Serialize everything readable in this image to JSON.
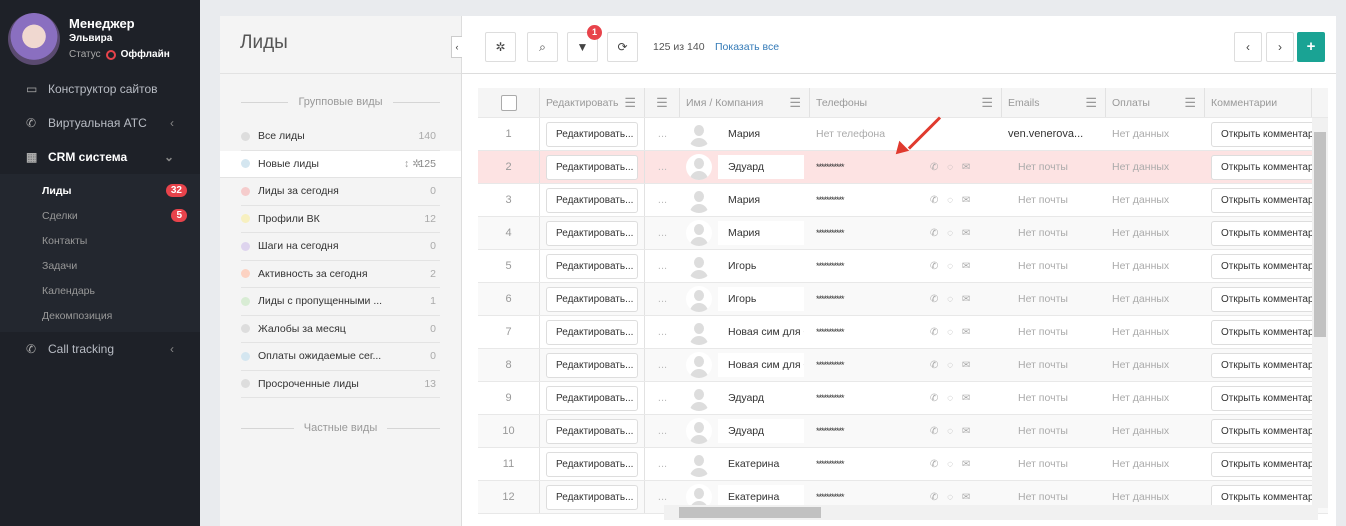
{
  "sidebar": {
    "user_role": "Менеджер",
    "user_name": "Эльвира",
    "status_label": "Статус",
    "status_value": "Оффлайн",
    "nav": [
      {
        "label": "Конструктор сайтов",
        "icon": "monitor-icon"
      },
      {
        "label": "Виртуальная АТС",
        "icon": "phone-icon"
      },
      {
        "label": "CRM система",
        "icon": "calendar-icon"
      },
      {
        "label": "Call tracking",
        "icon": "call-tracking-icon"
      }
    ],
    "crm_sub": [
      {
        "label": "Лиды",
        "badge": "32"
      },
      {
        "label": "Сделки",
        "badge": "5"
      },
      {
        "label": "Контакты"
      },
      {
        "label": "Задачи"
      },
      {
        "label": "Календарь"
      },
      {
        "label": "Декомпозиция"
      }
    ]
  },
  "leftpanel": {
    "title": "Лиды",
    "group_header": "Групповые виды",
    "private_header": "Частные виды",
    "groups": [
      {
        "label": "Все лиды",
        "count": "140",
        "color": "#dddddd"
      },
      {
        "label": "Новые лиды",
        "count": "125",
        "color": "#d4e6f0"
      },
      {
        "label": "Лиды за сегодня",
        "count": "0",
        "color": "#f5cccc"
      },
      {
        "label": "Профили ВК",
        "count": "12",
        "color": "#f7f0c0"
      },
      {
        "label": "Шаги на сегодня",
        "count": "0",
        "color": "#ded4ee"
      },
      {
        "label": "Активность за сегодня",
        "count": "2",
        "color": "#fcd2c2"
      },
      {
        "label": "Лиды с пропущенными ...",
        "count": "1",
        "color": "#d8ecd4"
      },
      {
        "label": "Жалобы за месяц",
        "count": "0",
        "color": "#dddddd"
      },
      {
        "label": "Оплаты ожидаемые сег...",
        "count": "0",
        "color": "#d4e6f0"
      },
      {
        "label": "Просроченные лиды",
        "count": "13",
        "color": "#dddddd"
      }
    ]
  },
  "toolbar": {
    "filter_badge": "1",
    "count_text": "125 из 140",
    "show_all": "Показать все"
  },
  "table": {
    "headers": [
      "Редактировать",
      "Имя / Компания",
      "Телефоны",
      "Emails",
      "Оплаты",
      "Комментарии"
    ],
    "edit_label": "Редактировать...",
    "comment_label": "Открыть комментарии",
    "dots": "...",
    "rows": [
      {
        "n": "1",
        "name": "Мария",
        "phone": "Нет телефона",
        "email": "ven.venerova...",
        "pay": "Нет данных"
      },
      {
        "n": "2",
        "name": "Эдуард",
        "phone": "***********",
        "email": "Нет почты",
        "pay": "Нет данных"
      },
      {
        "n": "3",
        "name": "Мария",
        "phone": "***********",
        "email": "Нет почты",
        "pay": "Нет данных"
      },
      {
        "n": "4",
        "name": "Мария",
        "phone": "***********",
        "email": "Нет почты",
        "pay": "Нет данных"
      },
      {
        "n": "5",
        "name": "Игорь",
        "phone": "***********",
        "email": "Нет почты",
        "pay": "Нет данных"
      },
      {
        "n": "6",
        "name": "Игорь",
        "phone": "***********",
        "email": "Нет почты",
        "pay": "Нет данных"
      },
      {
        "n": "7",
        "name": "Новая сим для С",
        "phone": "***********",
        "email": "Нет почты",
        "pay": "Нет данных"
      },
      {
        "n": "8",
        "name": "Новая сим для С",
        "phone": "***********",
        "email": "Нет почты",
        "pay": "Нет данных"
      },
      {
        "n": "9",
        "name": "Эдуард",
        "phone": "***********",
        "email": "Нет почты",
        "pay": "Нет данных"
      },
      {
        "n": "10",
        "name": "Эдуард",
        "phone": "***********",
        "email": "Нет почты",
        "pay": "Нет данных"
      },
      {
        "n": "11",
        "name": "Екатерина",
        "phone": "***********",
        "email": "Нет почты",
        "pay": "Нет данных"
      },
      {
        "n": "12",
        "name": "Екатерина",
        "phone": "***********",
        "email": "Нет почты",
        "pay": "Нет данных"
      }
    ]
  },
  "colors": {
    "accent": "#1aa394",
    "badge": "#e8434b",
    "highlight_row": "#fde3e3",
    "link": "#337ab7"
  }
}
